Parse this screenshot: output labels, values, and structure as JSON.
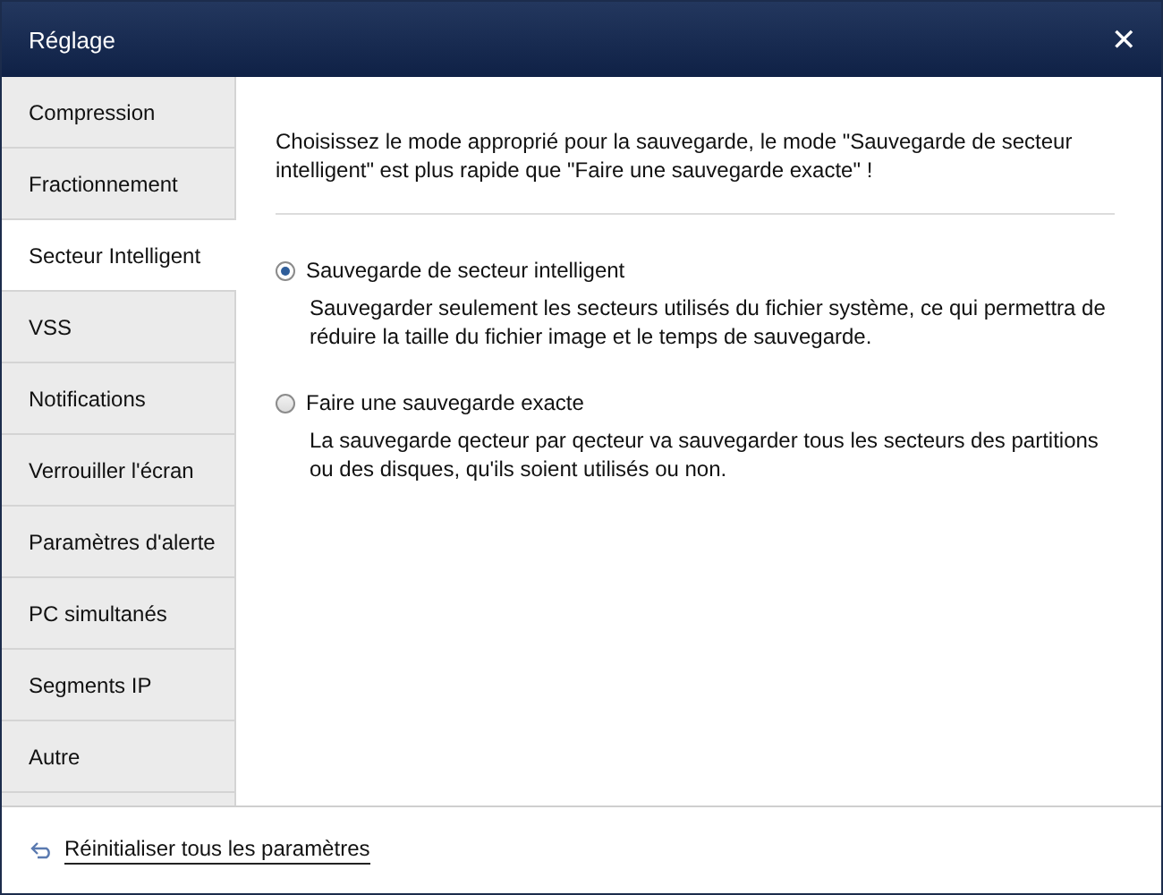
{
  "window": {
    "title": "Réglage",
    "close": "✕"
  },
  "sidebar": {
    "items": [
      {
        "label": "Compression",
        "selected": false
      },
      {
        "label": "Fractionnement",
        "selected": false
      },
      {
        "label": "Secteur Intelligent",
        "selected": true
      },
      {
        "label": "VSS",
        "selected": false
      },
      {
        "label": "Notifications",
        "selected": false
      },
      {
        "label": "Verrouiller l'écran",
        "selected": false
      },
      {
        "label": "Paramètres d'alerte",
        "selected": false
      },
      {
        "label": "PC simultanés",
        "selected": false
      },
      {
        "label": "Segments IP",
        "selected": false
      },
      {
        "label": "Autre",
        "selected": false
      }
    ]
  },
  "content": {
    "intro": " Choisissez le mode approprié pour la sauvegarde, le mode \"Sauvegarde de secteur intelligent\" est plus rapide que \"Faire une sauvegarde exacte\" !",
    "options": [
      {
        "label": "Sauvegarde de secteur intelligent",
        "selected": true,
        "description": "Sauvegarder seulement les secteurs utilisés du fichier système, ce qui permettra de réduire la taille du fichier image et le temps de sauvegarde."
      },
      {
        "label": "Faire une sauvegarde exacte",
        "selected": false,
        "description": "La sauvegarde qecteur par qecteur va sauvegarder tous les secteurs des partitions ou des disques, qu'ils soient utilisés ou non."
      }
    ]
  },
  "footer": {
    "reset_link": "Réinitialiser tous les paramètres"
  }
}
